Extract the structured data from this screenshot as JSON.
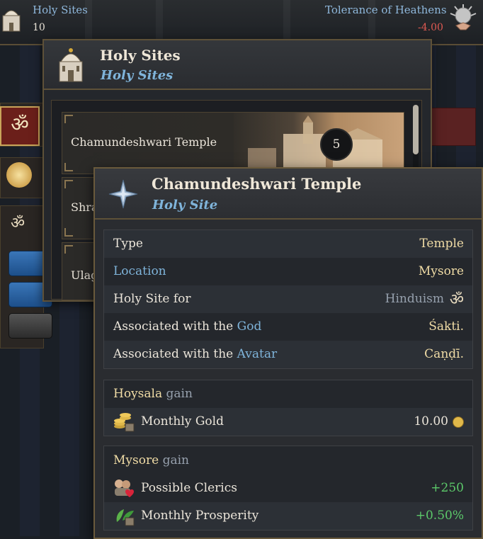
{
  "topbar": {
    "holy_sites_label": "Holy Sites",
    "holy_sites_value": "10",
    "tolerance_label": "Tolerance of Heathens",
    "tolerance_value": "-4.00",
    "tolerance_color": "#e05a52"
  },
  "list_window": {
    "title": "Holy Sites",
    "subtitle": "Holy Sites",
    "rows": [
      {
        "label": "Chamundeshwari Temple",
        "count": "5"
      },
      {
        "label": "Shra"
      },
      {
        "label": "Ulag"
      }
    ]
  },
  "tooltip": {
    "title": "Chamundeshwari Temple",
    "subtitle": "Holy Site",
    "icon": "compass-star-icon",
    "info": {
      "type_label": "Type",
      "type_value": "Temple",
      "location_label": "Location",
      "location_value": "Mysore",
      "holy_site_for_label": "Holy Site for",
      "holy_site_for_value": "Hinduism",
      "god_prefix": "Associated with the ",
      "god_label": "God",
      "god_value": "Śakti.",
      "avatar_prefix": "Associated with the ",
      "avatar_label": "Avatar",
      "avatar_value": "Caṇḍī."
    },
    "gain_groups": [
      {
        "owner": "Hoysala",
        "suffix": "gain",
        "items": [
          {
            "icon": "gold-coins-icon",
            "label": "Monthly Gold",
            "value": "10.00"
          }
        ]
      },
      {
        "owner": "Mysore",
        "suffix": "gain",
        "items": [
          {
            "icon": "clerics-icon",
            "label": "Possible Clerics",
            "value": "+250"
          },
          {
            "icon": "prosperity-icon",
            "label": "Monthly Prosperity",
            "value": "+0.50%"
          }
        ]
      }
    ]
  },
  "colors": {
    "accent_blue": "#7fb4da",
    "gold_text": "#f0dca6",
    "positive_green": "#5cc96a",
    "frame": "#6a5a3c"
  }
}
